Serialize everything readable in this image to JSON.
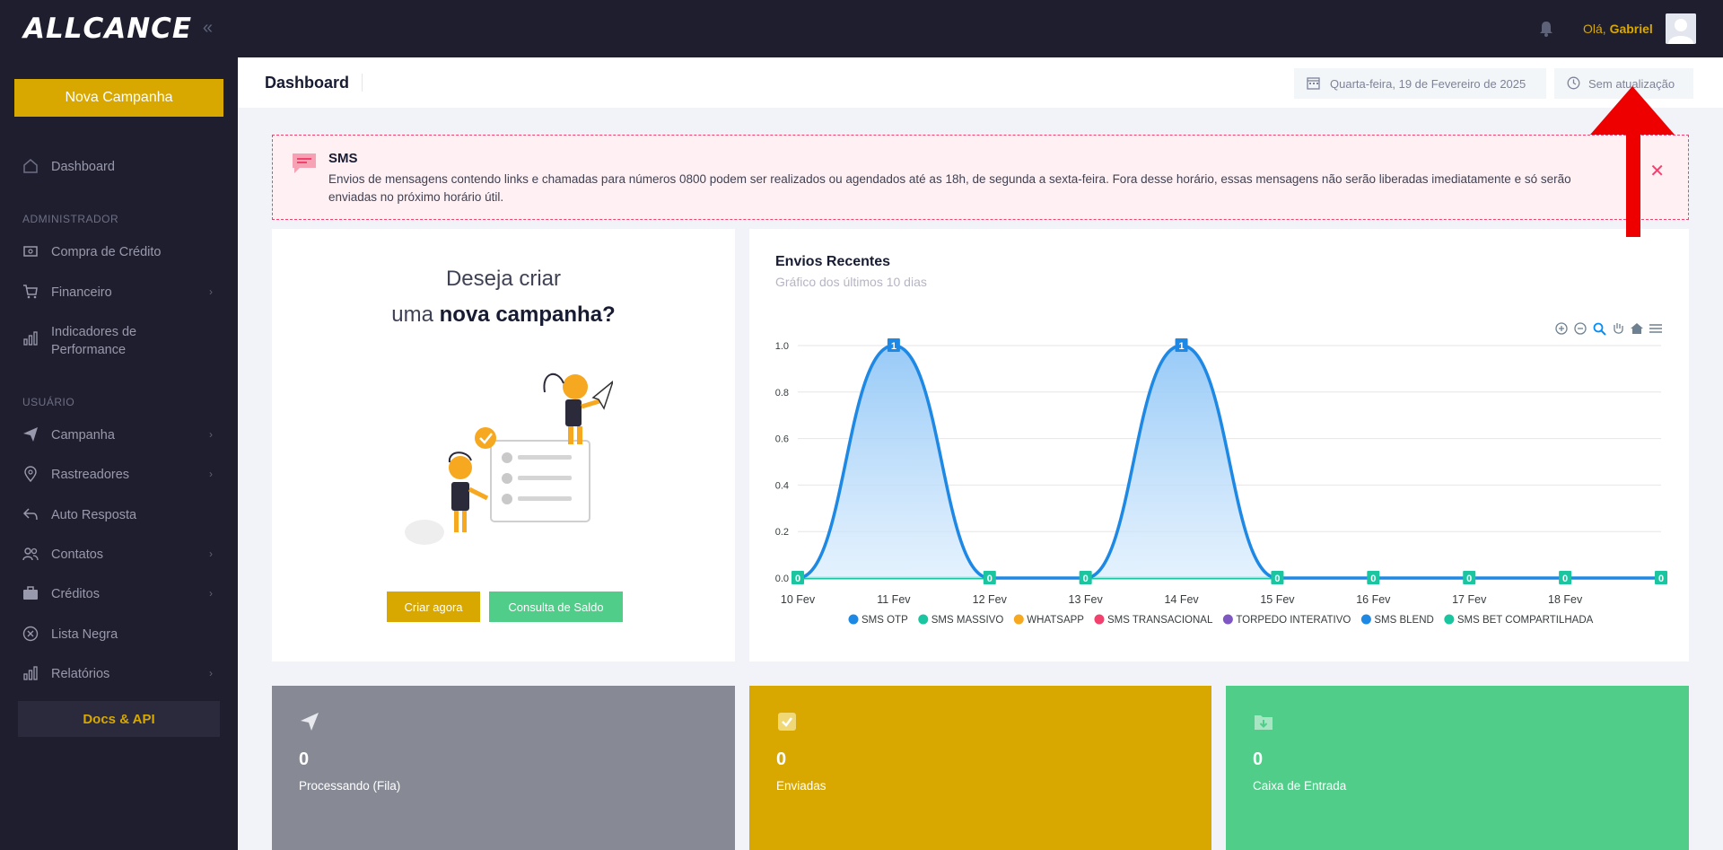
{
  "brand": {
    "logo": "ALLCANCE"
  },
  "sidebar": {
    "new_campaign": "Nova Campanha",
    "dashboard": "Dashboard",
    "section_admin": "ADMINISTRADOR",
    "admin_items": [
      "Compra de Crédito",
      "Financeiro",
      "Indicadores de Performance"
    ],
    "section_user": "USUÁRIO",
    "user_items": [
      "Campanha",
      "Rastreadores",
      "Auto Resposta",
      "Contatos",
      "Créditos",
      "Lista Negra",
      "Relatórios"
    ],
    "docs": "Docs & API"
  },
  "header": {
    "greeting": "Olá,",
    "username": "Gabriel"
  },
  "subheader": {
    "title": "Dashboard",
    "date": "Quarta-feira, 19 de Fevereiro de 2025",
    "update": "Sem atualização"
  },
  "alert": {
    "title": "SMS",
    "text": "Envios de mensagens contendo links e chamadas para números 0800 podem ser realizados ou agendados até as 18h, de segunda a sexta-feira. Fora desse horário, essas mensagens não serão liberadas imediatamente e só serão enviadas no próximo horário útil."
  },
  "cta": {
    "line1": "Deseja criar",
    "line2_prefix": "uma",
    "line2_bold": "nova campanha?",
    "create_btn": "Criar agora",
    "balance_btn": "Consulta de Saldo"
  },
  "chart": {
    "title": "Envios Recentes",
    "subtitle": "Gráfico dos últimos 10 dias"
  },
  "chart_data": {
    "type": "area",
    "title": "Envios Recentes",
    "subtitle": "Gráfico dos últimos 10 dias",
    "x": [
      "10 Fev",
      "11 Fev",
      "12 Fev",
      "13 Fev",
      "14 Fev",
      "15 Fev",
      "16 Fev",
      "17 Fev",
      "18 Fev",
      ""
    ],
    "ylim": [
      0,
      1
    ],
    "yticks": [
      "0.0",
      "0.2",
      "0.4",
      "0.6",
      "0.8",
      "1.0"
    ],
    "grid": true,
    "legend_position": "bottom",
    "series": [
      {
        "name": "SMS OTP",
        "color": "#1e88e5",
        "values": [
          0,
          1,
          0,
          0,
          1,
          0,
          0,
          0,
          0,
          0
        ]
      },
      {
        "name": "SMS MASSIVO",
        "color": "#1bc5a0",
        "values": [
          0,
          0,
          0,
          0,
          0,
          0,
          0,
          0,
          0,
          0
        ]
      },
      {
        "name": "WHATSAPP",
        "color": "#f6a821",
        "values": [
          0,
          0,
          0,
          0,
          0,
          0,
          0,
          0,
          0,
          0
        ]
      },
      {
        "name": "SMS TRANSACIONAL",
        "color": "#f1416c",
        "values": [
          0,
          0,
          0,
          0,
          0,
          0,
          0,
          0,
          0,
          0
        ]
      },
      {
        "name": "TORPEDO INTERATIVO",
        "color": "#7e57c2",
        "values": [
          0,
          0,
          0,
          0,
          0,
          0,
          0,
          0,
          0,
          0
        ]
      },
      {
        "name": "SMS BLEND",
        "color": "#1e88e5",
        "values": [
          0,
          0,
          0,
          0,
          0,
          0,
          0,
          0,
          0,
          0
        ]
      },
      {
        "name": "SMS BET COMPARTILHADA",
        "color": "#1bc5a0",
        "values": [
          0,
          0,
          0,
          0,
          0,
          0,
          0,
          0,
          0,
          0
        ]
      }
    ]
  },
  "stats": [
    {
      "value": "0",
      "label": "Processando (Fila)"
    },
    {
      "value": "0",
      "label": "Enviadas"
    },
    {
      "value": "0",
      "label": "Caixa de Entrada"
    }
  ],
  "colors": {
    "accent": "#d8a800",
    "sidebar_bg": "#1f1e2e",
    "success": "#50cd89",
    "danger": "#f1416c",
    "annotation_arrow": "#ee0000"
  }
}
